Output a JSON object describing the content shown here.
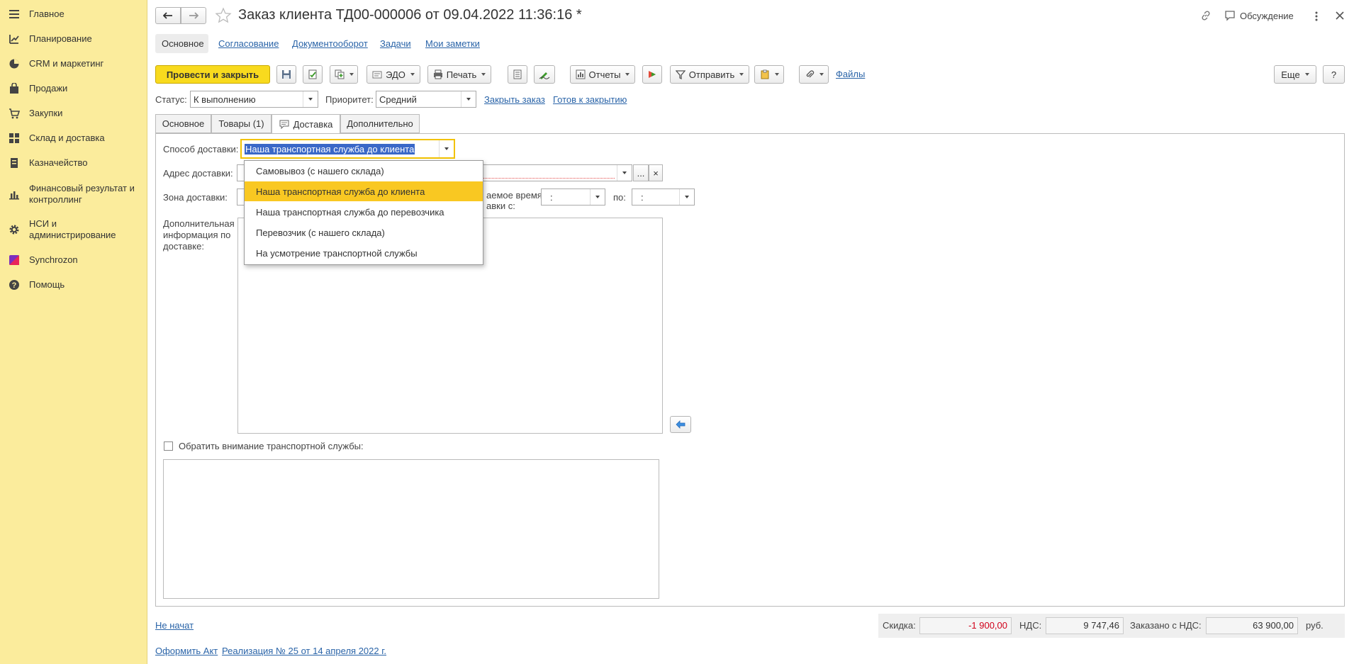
{
  "sidebar": {
    "items": [
      {
        "label": "Главное",
        "icon": "menu-icon"
      },
      {
        "label": "Планирование",
        "icon": "planning-icon"
      },
      {
        "label": "CRM и маркетинг",
        "icon": "pie-chart-icon"
      },
      {
        "label": "Продажи",
        "icon": "bag-icon"
      },
      {
        "label": "Закупки",
        "icon": "cart-icon"
      },
      {
        "label": "Склад и доставка",
        "icon": "warehouse-icon"
      },
      {
        "label": "Казначейство",
        "icon": "cash-icon"
      },
      {
        "label": "Финансовый результат и контроллинг",
        "icon": "bar-chart-icon"
      },
      {
        "label": "НСИ и администрирование",
        "icon": "gear-icon"
      },
      {
        "label": "Synchrozon",
        "icon": "synchrozon-logo-icon"
      },
      {
        "label": "Помощь",
        "icon": "help-icon"
      }
    ]
  },
  "header": {
    "title": "Заказ клиента ТД00-000006 от 09.04.2022 11:36:16 *",
    "discussion_label": "Обсуждение"
  },
  "subnav": {
    "items": [
      "Основное",
      "Согласование",
      "Документооборот",
      "Задачи",
      "Мои заметки"
    ]
  },
  "toolbar": {
    "post_close_label": "Провести и закрыть",
    "edo_label": "ЭДО",
    "print_label": "Печать",
    "reports_label": "Отчеты",
    "send_label": "Отправить",
    "files_label": "Файлы",
    "more_label": "Еще",
    "help_label": "?"
  },
  "status_row": {
    "status_label": "Статус:",
    "status_value": "К выполнению",
    "priority_label": "Приоритет:",
    "priority_value": "Средний",
    "close_order_link": "Закрыть заказ",
    "ready_to_close_link": "Готов к закрытию"
  },
  "tabs": [
    "Основное",
    "Товары (1)",
    "Доставка",
    "Дополнительно"
  ],
  "delivery": {
    "method_label": "Способ доставки:",
    "method_value": "Наша транспортная служба до клиента",
    "address_label": "Адрес доставки:",
    "zone_label": "Зона доставки:",
    "time_label_line1": "аемое время",
    "time_label_line2": "авки с:",
    "time_from": ":",
    "time_to_label": "по:",
    "time_to": ":",
    "extra_info_label": "Дополнительная информация по доставке:",
    "attention_label": "Обратить внимание транспортной службы:",
    "address_clear_btn": "×",
    "address_select_btn": "..."
  },
  "dropdown_options": [
    "Самовывоз (с нашего склада)",
    "Наша транспортная служба до клиента",
    "Наша транспортная служба до перевозчика",
    "Перевозчик (с нашего склада)",
    "На усмотрение транспортной службы"
  ],
  "dropdown_selected_index": 1,
  "footer": {
    "state_link": "Не начат",
    "act_link": "Оформить Акт",
    "realization_link": "Реализация № 25 от 14 апреля 2022 г.",
    "discount_label": "Скидка:",
    "discount_value": "-1 900,00",
    "vat_label": "НДС:",
    "vat_value": "9 747,46",
    "ordered_label": "Заказано с НДС:",
    "ordered_value": "63 900,00",
    "currency": "руб."
  },
  "colors": {
    "sidebar_bg": "#FBEC9C",
    "primary_button": "#F8DA1E",
    "link": "#2A64A8",
    "selected_option": "#F9C822",
    "negative_value": "#D0021B"
  }
}
